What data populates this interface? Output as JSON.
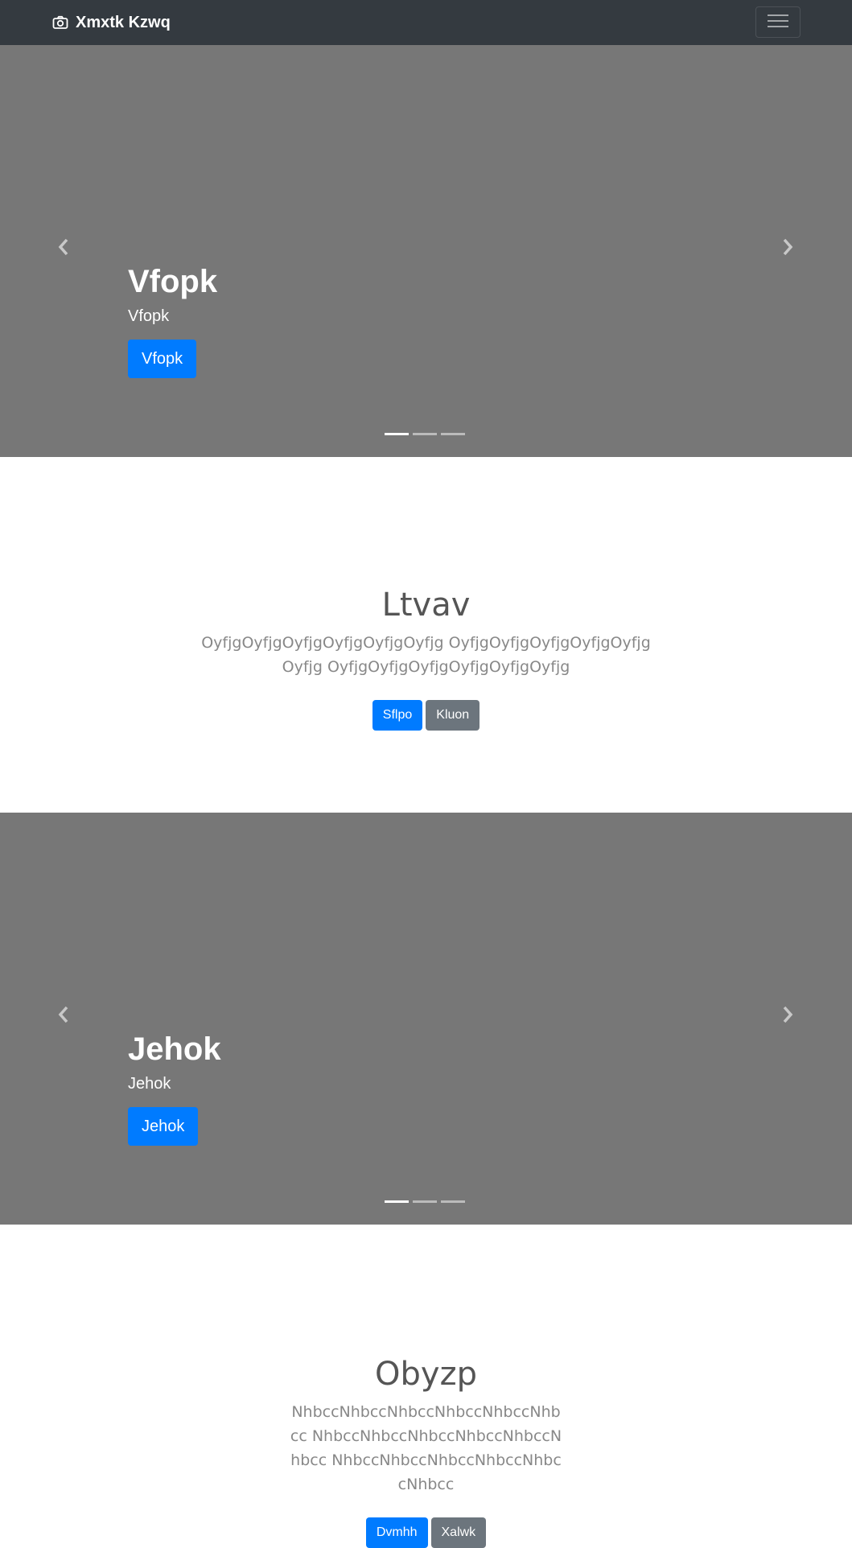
{
  "navbar": {
    "brand": "Xmxtk Kzwq",
    "brand_icon": "camera-icon",
    "toggler_icon": "hamburger-menu-icon",
    "background": "#343a40"
  },
  "hero_1": {
    "title": "Vfopk",
    "subtitle": "Vfopk",
    "button": "Vfopk",
    "indicator_count": 3,
    "active_indicator": 1,
    "background": "#777777"
  },
  "section_1": {
    "heading": "Ltvav",
    "lead": "OyfjgOyfjgOyfjgOyfjgOyfjgOyfjg OyfjgOyfjgOyfjgOyfjgOyfjgOyfjg OyfjgOyfjgOyfjgOyfjgOyfjgOyfjg",
    "primary_button": "Sflpo",
    "secondary_button": "Kluon"
  },
  "hero_2": {
    "title": "Jehok",
    "subtitle": "Jehok",
    "button": "Jehok",
    "indicator_count": 3,
    "active_indicator": 1,
    "background": "#777777"
  },
  "section_2": {
    "heading": "Obyzp",
    "lead": "NhbccNhbccNhbccNhbccNhbccNhbcc NhbccNhbccNhbccNhbccNhbccNhbcc NhbccNhbccNhbccNhbccNhbccNhbcc",
    "primary_button": "Dvmhh",
    "secondary_button": "Xalwk"
  },
  "colors": {
    "primary": "#007bff",
    "secondary": "#6c757d",
    "muted_text": "#888888"
  }
}
